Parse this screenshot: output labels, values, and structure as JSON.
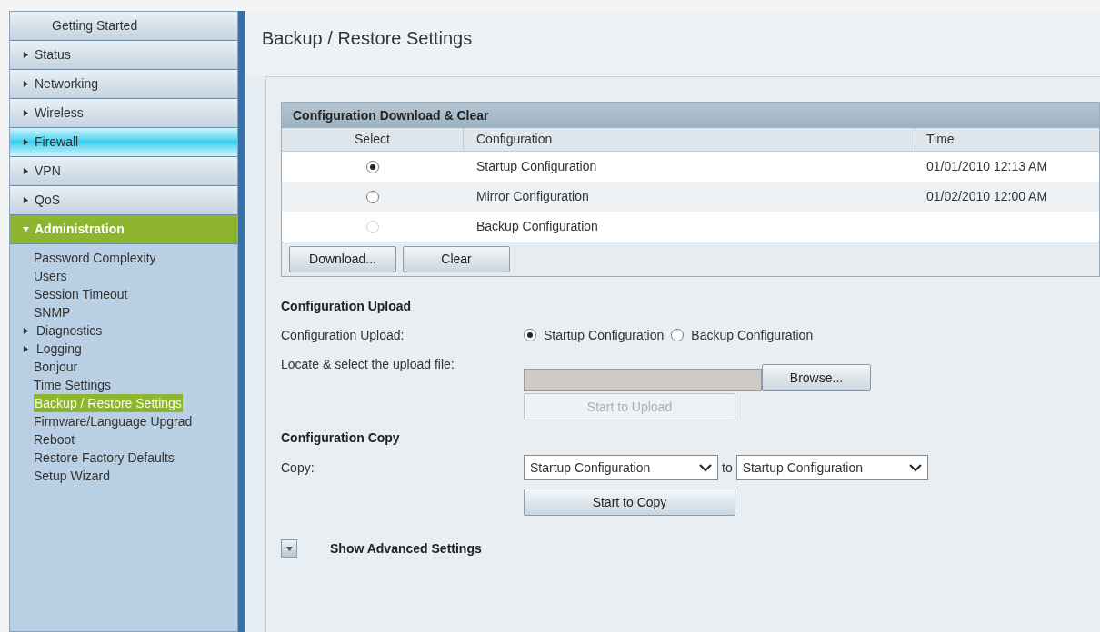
{
  "sidebar": {
    "items": [
      {
        "label": "Getting Started",
        "kind": "plain",
        "hovered": false,
        "selected": false
      },
      {
        "label": "Status",
        "kind": "section",
        "expanded": false,
        "hovered": false,
        "selected": false
      },
      {
        "label": "Networking",
        "kind": "section",
        "expanded": false,
        "hovered": false,
        "selected": false
      },
      {
        "label": "Wireless",
        "kind": "section",
        "expanded": false,
        "hovered": false,
        "selected": false
      },
      {
        "label": "Firewall",
        "kind": "section",
        "expanded": false,
        "hovered": true,
        "selected": false
      },
      {
        "label": "VPN",
        "kind": "section",
        "expanded": false,
        "hovered": false,
        "selected": false
      },
      {
        "label": "QoS",
        "kind": "section",
        "expanded": false,
        "hovered": false,
        "selected": false
      },
      {
        "label": "Administration",
        "kind": "section",
        "expanded": true,
        "hovered": false,
        "selected": true,
        "children": [
          {
            "label": "Password Complexity",
            "kind": "page",
            "selected": false
          },
          {
            "label": "Users",
            "kind": "page",
            "selected": false
          },
          {
            "label": "Session Timeout",
            "kind": "page",
            "selected": false
          },
          {
            "label": "SNMP",
            "kind": "page",
            "selected": false
          },
          {
            "label": "Diagnostics",
            "kind": "group",
            "selected": false
          },
          {
            "label": "Logging",
            "kind": "group",
            "selected": false
          },
          {
            "label": "Bonjour",
            "kind": "page",
            "selected": false
          },
          {
            "label": "Time Settings",
            "kind": "page",
            "selected": false
          },
          {
            "label": "Backup / Restore Settings",
            "kind": "page",
            "selected": true
          },
          {
            "label": "Firmware/Language Upgrad",
            "kind": "page",
            "selected": false
          },
          {
            "label": "Reboot",
            "kind": "page",
            "selected": false
          },
          {
            "label": "Restore Factory Defaults",
            "kind": "page",
            "selected": false
          },
          {
            "label": "Setup Wizard",
            "kind": "page",
            "selected": false
          }
        ]
      }
    ]
  },
  "page_title": "Backup / Restore Settings",
  "download_table": {
    "title": "Configuration Download & Clear",
    "columns": [
      "Select",
      "Configuration",
      "Time"
    ],
    "rows": [
      {
        "selected": true,
        "disabled": false,
        "configuration": "Startup Configuration",
        "time": "01/01/2010 12:13 AM"
      },
      {
        "selected": false,
        "disabled": false,
        "configuration": "Mirror Configuration",
        "time": "01/02/2010 12:00 AM"
      },
      {
        "selected": false,
        "disabled": true,
        "configuration": "Backup Configuration"
      }
    ],
    "buttons": [
      "Download...",
      "Clear"
    ]
  },
  "upload": {
    "heading": "Configuration Upload",
    "label": "Configuration Upload:",
    "options": [
      {
        "label": "Startup Configuration",
        "selected": true
      },
      {
        "label": "Backup Configuration",
        "selected": false
      }
    ],
    "file_label": "Locate & select the upload file:",
    "browse_button": "Browse...",
    "upload_button": {
      "label": "Start to Upload",
      "disabled": true
    }
  },
  "copy": {
    "heading": "Configuration Copy",
    "label": "Copy:",
    "from": "Startup Configuration",
    "joiner": "to",
    "to": "Startup Configuration",
    "button": "Start to Copy"
  },
  "advanced": {
    "label": "Show Advanced Settings",
    "expanded": false
  }
}
